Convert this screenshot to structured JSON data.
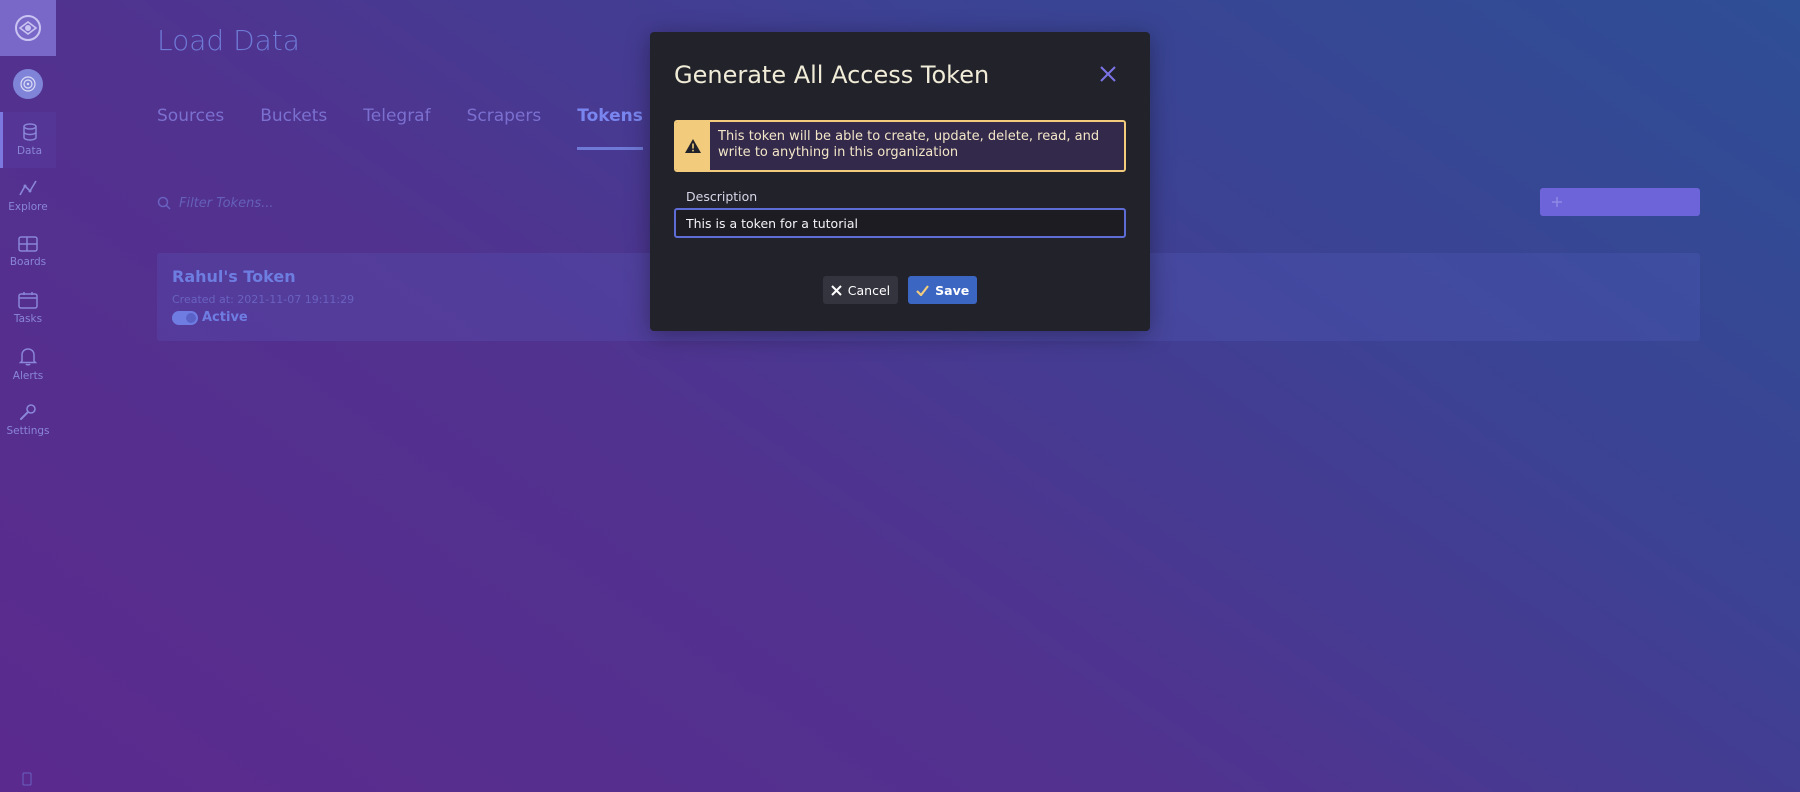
{
  "sidebar": {
    "items": [
      {
        "label": "Data",
        "icon": "database-icon",
        "active": true
      },
      {
        "label": "Explore",
        "icon": "graph-icon"
      },
      {
        "label": "Boards",
        "icon": "dashboard-icon"
      },
      {
        "label": "Tasks",
        "icon": "calendar-icon"
      },
      {
        "label": "Alerts",
        "icon": "bell-icon"
      },
      {
        "label": "Settings",
        "icon": "wrench-icon"
      }
    ]
  },
  "page": {
    "title": "Load Data",
    "tabs": [
      "Sources",
      "Buckets",
      "Telegraf",
      "Scrapers",
      "Tokens"
    ],
    "active_tab": "Tokens"
  },
  "filter": {
    "placeholder": "Filter Tokens..."
  },
  "tokens": [
    {
      "name": "Rahul's Token",
      "created": "Created at: 2021-11-07 19:11:29",
      "status": "Active"
    }
  ],
  "modal": {
    "title": "Generate All Access Token",
    "warning": "This token will be able to create, update, delete, read, and write to anything in this organization",
    "description_label": "Description",
    "description_value": "This is a token for a tutorial",
    "cancel_label": "Cancel",
    "save_label": "Save"
  },
  "colors": {
    "accent": "#5e6cd6",
    "warning": "#f2cc7c",
    "modal_bg": "#22222a",
    "save": "#3b66c2"
  }
}
